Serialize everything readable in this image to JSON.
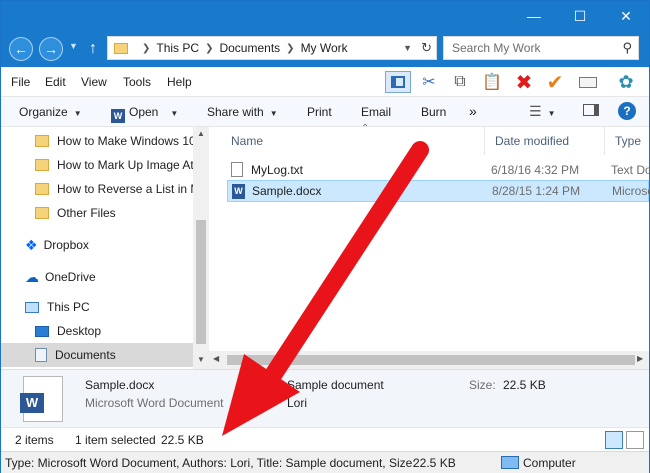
{
  "nav": {
    "address_crumbs": [
      "This PC",
      "Documents",
      "My Work"
    ],
    "search_placeholder": "Search My Work"
  },
  "menu": [
    "File",
    "Edit",
    "View",
    "Tools",
    "Help"
  ],
  "commands": {
    "organize": "Organize",
    "open": "Open",
    "share_with": "Share with",
    "print": "Print",
    "email": "Email",
    "burn": "Burn",
    "more": "»"
  },
  "sidebar": {
    "items": [
      {
        "label": "How to Make Windows 10",
        "icon": "folder-icon"
      },
      {
        "label": "How to Mark Up Image At",
        "icon": "folder-icon"
      },
      {
        "label": "How to Reverse a List in M",
        "icon": "folder-icon"
      },
      {
        "label": "Other Files",
        "icon": "folder-icon"
      },
      {
        "label": "Dropbox",
        "icon": "dropbox-icon"
      },
      {
        "label": "OneDrive",
        "icon": "onedrive-icon"
      },
      {
        "label": "This PC",
        "icon": "computer-icon"
      },
      {
        "label": "Desktop",
        "icon": "desktop-icon"
      },
      {
        "label": "Documents",
        "icon": "documents-icon"
      }
    ]
  },
  "columns": {
    "name": "Name",
    "date": "Date modified",
    "type": "Type"
  },
  "files": [
    {
      "name": "MyLog.txt",
      "date": "6/18/16 4:32 PM",
      "type": "Text Do",
      "selected": false
    },
    {
      "name": "Sample.docx",
      "date": "8/28/15 1:24 PM",
      "type": "Microsc",
      "selected": true
    }
  ],
  "details": {
    "filename": "Sample.docx",
    "filetype": "Microsoft Word Document",
    "title": "Sample document",
    "author": "Lori",
    "size_label": "Size:",
    "size": "22.5 KB"
  },
  "status": {
    "count": "2 items",
    "selected": "1 item selected",
    "size": "22.5 KB"
  },
  "status2": {
    "summary": "Type: Microsoft Word Document, Authors: Lori, Title: Sample document, Size:",
    "size": "22.5 KB",
    "location": "Computer"
  },
  "colors": {
    "titlebar": "#1979ca",
    "selection": "#cce8ff",
    "arrow": "#e8141a"
  }
}
